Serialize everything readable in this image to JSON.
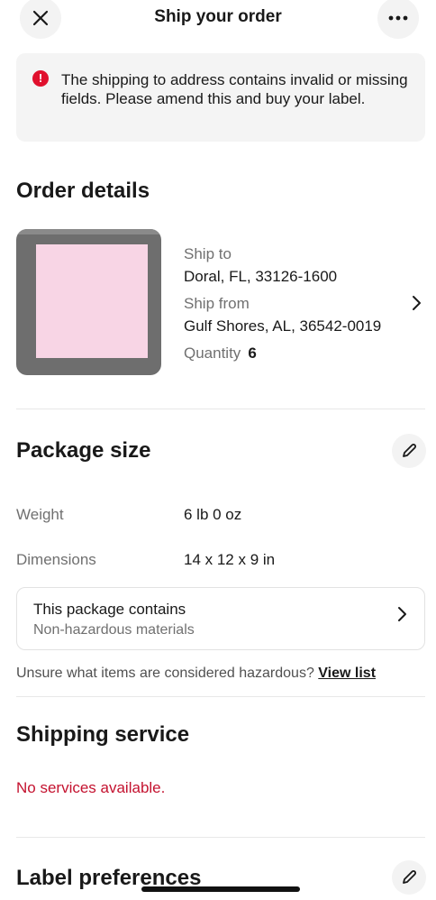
{
  "header": {
    "title": "Ship your order",
    "close_icon": "close-icon",
    "more_icon": "more-horizontal-icon"
  },
  "alert": {
    "icon": "error-icon",
    "icon_glyph": "!",
    "message": "The shipping to address contains invalid or missing fields. Please amend this and buy your label."
  },
  "order_details": {
    "title": "Order details",
    "ship_to_label": "Ship to",
    "ship_to_value": "Doral, FL, 33126-1600",
    "ship_from_label": "Ship from",
    "ship_from_value": "Gulf Shores, AL, 36542-0019",
    "quantity_label": "Quantity",
    "quantity_value": "6"
  },
  "package_size": {
    "title": "Package size",
    "weight_label": "Weight",
    "weight_value": "6 lb 0 oz",
    "dimensions_label": "Dimensions",
    "dimensions_value": "14 x 12 x 9 in",
    "contents_title": "This package contains",
    "contents_value": "Non-hazardous materials",
    "hazard_question": "Unsure what items are considered hazardous?",
    "hazard_link": "View list"
  },
  "shipping_service": {
    "title": "Shipping service",
    "status": "No services available."
  },
  "label_preferences": {
    "title": "Label preferences"
  },
  "colors": {
    "error": "#c4122f",
    "alert_icon": "#e0102d",
    "text": "#191919",
    "muted": "#707070"
  }
}
